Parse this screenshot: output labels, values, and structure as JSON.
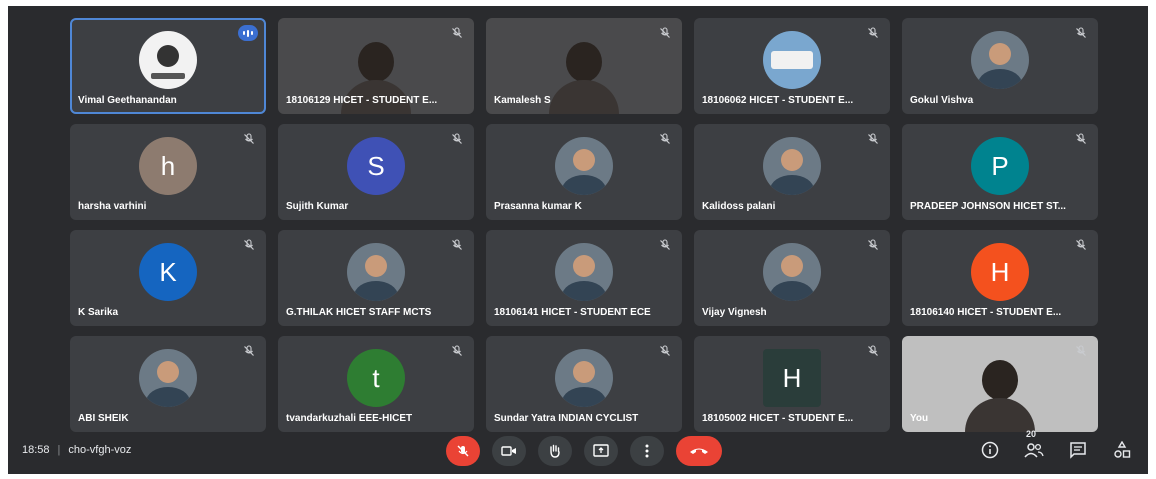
{
  "meeting": {
    "time": "18:58",
    "separator": "|",
    "code": "cho-vfgh-voz",
    "participant_count": "20"
  },
  "participants": [
    {
      "name": "Vimal Geethanandan",
      "avatar": "logo",
      "state": "speaking"
    },
    {
      "name": "18106129 HICET - STUDENT E...",
      "avatar": "video",
      "state": "muted"
    },
    {
      "name": "Kamalesh S",
      "avatar": "video",
      "state": "muted"
    },
    {
      "name": "18106062 HICET - STUDENT E...",
      "avatar": "bus",
      "state": "muted"
    },
    {
      "name": "Gokul Vishva",
      "avatar": "photo",
      "state": "muted"
    },
    {
      "name": "harsha varhini",
      "avatar": "letter",
      "letter": "h",
      "color": "#8d7b6f",
      "state": "muted"
    },
    {
      "name": "Sujith Kumar",
      "avatar": "letter",
      "letter": "S",
      "color": "#3f51b5",
      "state": "muted"
    },
    {
      "name": "Prasanna kumar K",
      "avatar": "photo",
      "state": "muted"
    },
    {
      "name": "Kalidoss palani",
      "avatar": "photo",
      "state": "muted"
    },
    {
      "name": "PRADEEP JOHNSON HICET ST...",
      "avatar": "letter",
      "letter": "P",
      "color": "#00838f",
      "state": "muted"
    },
    {
      "name": "K Sarika",
      "avatar": "letter",
      "letter": "K",
      "color": "#1565c0",
      "state": "muted"
    },
    {
      "name": "G.THILAK HICET STAFF MCTS",
      "avatar": "photo",
      "state": "muted"
    },
    {
      "name": "18106141 HICET - STUDENT ECE",
      "avatar": "photo",
      "state": "muted"
    },
    {
      "name": "Vijay Vignesh",
      "avatar": "photo",
      "state": "muted"
    },
    {
      "name": "18106140 HICET - STUDENT E...",
      "avatar": "letter",
      "letter": "H",
      "color": "#f4511e",
      "state": "muted"
    },
    {
      "name": "ABI SHEIK",
      "avatar": "photo",
      "state": "muted"
    },
    {
      "name": "tvandarkuzhali EEE-HICET",
      "avatar": "letter",
      "letter": "t",
      "color": "#2e7d32",
      "state": "muted"
    },
    {
      "name": "Sundar Yatra INDIAN CYCLIST",
      "avatar": "photo",
      "state": "muted"
    },
    {
      "name": "18105002 HICET - STUDENT E...",
      "avatar": "square",
      "letter": "H",
      "color": "#2a3d3a",
      "state": "muted"
    },
    {
      "name": "You",
      "avatar": "video-light",
      "state": "muted"
    }
  ],
  "icons": {
    "mic": "mic-off-icon",
    "camera": "camera-icon",
    "hand": "raise-hand-icon",
    "present": "present-screen-icon",
    "more": "more-options-icon",
    "hangup": "hang-up-icon",
    "info": "info-icon",
    "people": "people-icon",
    "chat": "chat-icon",
    "activities": "activities-icon"
  },
  "colors": {
    "background": "#2a2b2e",
    "tile": "#3d3f43",
    "active_border": "#4f87d6",
    "red": "#ea4335"
  }
}
